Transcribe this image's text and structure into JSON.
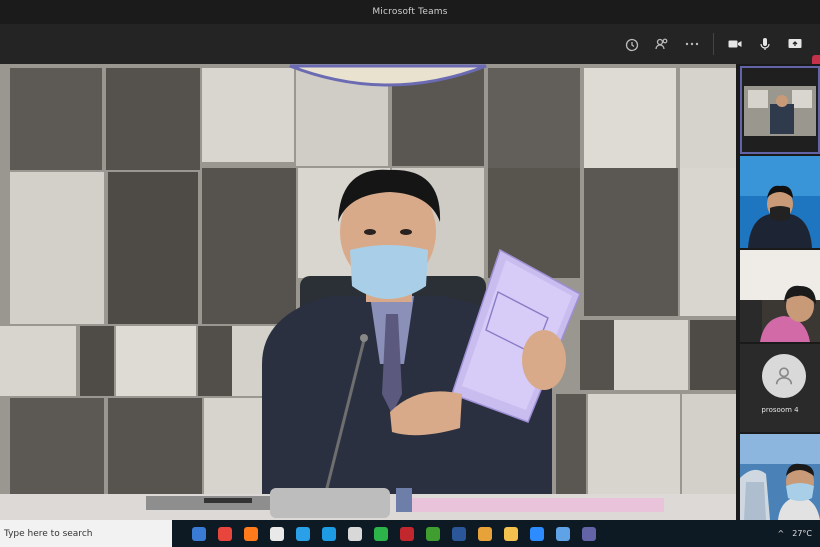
{
  "window": {
    "title": "Microsoft Teams"
  },
  "controls": {
    "icons": [
      "timer-icon",
      "participants-icon",
      "more-icon",
      "camera-icon",
      "mic-icon",
      "share-icon"
    ]
  },
  "gallery": {
    "avatar_name": "prosoom 4"
  },
  "taskbar": {
    "search_placeholder": "Type here to search",
    "weather": "27°C",
    "apps": [
      {
        "name": "taskview-icon",
        "color": "#3a7bd5"
      },
      {
        "name": "chrome-icon",
        "color": "#e8453c"
      },
      {
        "name": "firefox-icon",
        "color": "#ff7a1a"
      },
      {
        "name": "camera-app-icon",
        "color": "#e9e9e9"
      },
      {
        "name": "photos-icon",
        "color": "#2aa0e8"
      },
      {
        "name": "edge-icon",
        "color": "#1d9be3"
      },
      {
        "name": "pdf-icon",
        "color": "#d8d8d8"
      },
      {
        "name": "line-icon",
        "color": "#2cb34a"
      },
      {
        "name": "powerpoint-icon",
        "color": "#c1272d"
      },
      {
        "name": "xbox-icon",
        "color": "#3f9e2f"
      },
      {
        "name": "word-icon",
        "color": "#2b579a"
      },
      {
        "name": "store-icon",
        "color": "#e8a23a"
      },
      {
        "name": "explorer-icon",
        "color": "#f2c14e"
      },
      {
        "name": "zoom-icon",
        "color": "#2d8cff"
      },
      {
        "name": "mail-icon",
        "color": "#5fa3e6"
      },
      {
        "name": "teams-icon",
        "color": "#6264a7"
      }
    ]
  }
}
